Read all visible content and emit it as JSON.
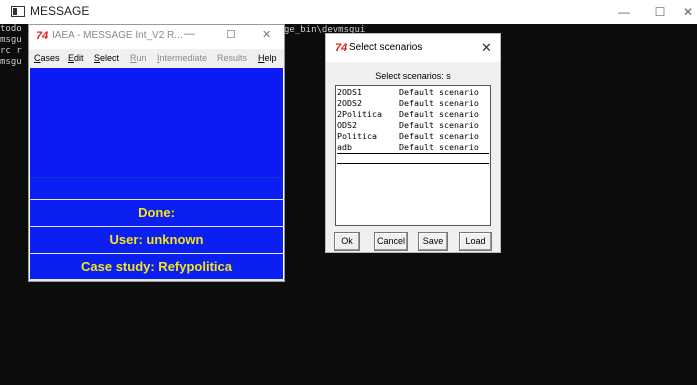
{
  "console": {
    "title": "MESSAGE",
    "minimize": "—",
    "maximize": "☐",
    "close": "✕",
    "lines": [
      "todo",
      "msgu",
      "rc r",
      "msgu"
    ],
    "path_text": "ge_bin\\devmsgui"
  },
  "main_window": {
    "icon": "74",
    "title": "IAEA - MESSAGE Int_V2 R...",
    "minimize": "—",
    "maximize": "☐",
    "close": "✕",
    "menu": [
      {
        "label": "Cases",
        "underline": "C",
        "rest": "ases",
        "enabled": true
      },
      {
        "label": "Edit",
        "underline": "E",
        "rest": "dit",
        "enabled": true
      },
      {
        "label": "Select",
        "underline": "S",
        "rest": "elect",
        "enabled": true
      },
      {
        "label": "Run",
        "underline": "R",
        "rest": "un",
        "enabled": false
      },
      {
        "label": "Intermediate",
        "underline": "I",
        "rest": "ntermediate",
        "enabled": false
      },
      {
        "label": "Results",
        "underline": "",
        "rest": "Results",
        "enabled": false
      },
      {
        "label": "Help",
        "underline": "H",
        "rest": "elp",
        "enabled": true
      }
    ],
    "status": {
      "done": "Done:",
      "user": "User: unknown",
      "case_study": "Case study: Refypolitica",
      "extra": ""
    },
    "colors": {
      "panel_bg": "#0b1ff2",
      "status_text": "#f2e61a"
    }
  },
  "dialog": {
    "icon": "74",
    "title": "Select scenarios",
    "close": "✕",
    "label": "Select scenarios: s",
    "scenarios": [
      {
        "name": "2ODS1",
        "description": "Default scenario"
      },
      {
        "name": "2ODS2",
        "description": "Default scenario"
      },
      {
        "name": "2Politica",
        "description": "Default scenario"
      },
      {
        "name": "ODS2",
        "description": "Default scenario"
      },
      {
        "name": "Politica",
        "description": "Default scenario"
      },
      {
        "name": "adb",
        "description": "Default scenario"
      }
    ],
    "buttons": {
      "ok": "Ok",
      "cancel": "Cancel",
      "save": "Save",
      "load": "Load"
    }
  }
}
